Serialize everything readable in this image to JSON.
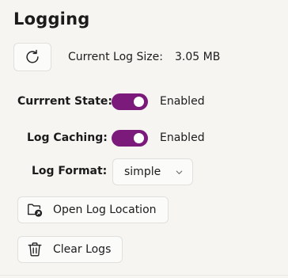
{
  "section": {
    "title": "Logging"
  },
  "log_size": {
    "label": "Current Log Size:",
    "value": "3.05 MB"
  },
  "current_state": {
    "label": "Currrent State:",
    "status": "Enabled",
    "on": true
  },
  "log_caching": {
    "label": "Log Caching:",
    "status": "Enabled",
    "on": true
  },
  "log_format": {
    "label": "Log Format:",
    "selected": "simple"
  },
  "buttons": {
    "open_location": "Open Log Location",
    "clear_logs": "Clear Logs"
  },
  "icons": {
    "refresh": "refresh-icon",
    "folder": "folder-open-icon",
    "trash": "trash-icon",
    "chevron": "chevron-down-icon"
  },
  "colors": {
    "toggle_on": "#7b1a7b",
    "background": "#f6f5f2"
  }
}
